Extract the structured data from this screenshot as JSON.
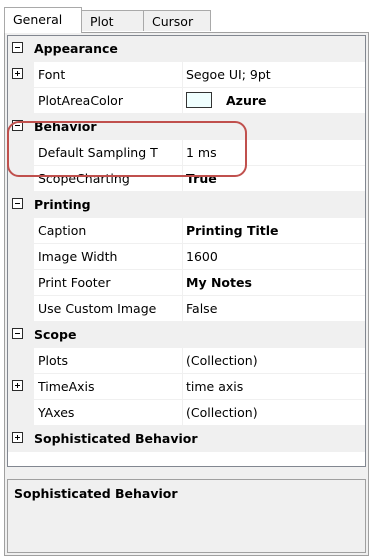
{
  "tabs": {
    "general": "General",
    "plot": "Plot",
    "cursor": "Cursor"
  },
  "accent": "#c0504d",
  "grid": {
    "appearance": "Appearance",
    "font_name": "Font",
    "font_value": "Segoe UI; 9pt",
    "plotareacolor_name": "PlotAreaColor",
    "plotareacolor_value": "Azure",
    "plotareacolor_swatch": "#f0ffff",
    "behavior": "Behavior",
    "sampling_name": "Default Sampling T",
    "sampling_value": "1 ms",
    "scopecharting_name": "ScopeCharting",
    "scopecharting_value": "True",
    "printing": "Printing",
    "caption_name": "Caption",
    "caption_value": "Printing Title",
    "imagewidth_name": "Image Width",
    "imagewidth_value": "1600",
    "printfooter_name": "Print Footer",
    "printfooter_value": "My Notes",
    "usecustomimage_name": "Use Custom Image",
    "usecustomimage_value": "False",
    "scope": "Scope",
    "plots_name": "Plots",
    "plots_value": "(Collection)",
    "timeaxis_name": "TimeAxis",
    "timeaxis_value": "time axis",
    "yaxes_name": "YAxes",
    "yaxes_value": "(Collection)",
    "sophisticated": "Sophisticated Behavior"
  },
  "description": {
    "title": "Sophisticated Behavior"
  }
}
